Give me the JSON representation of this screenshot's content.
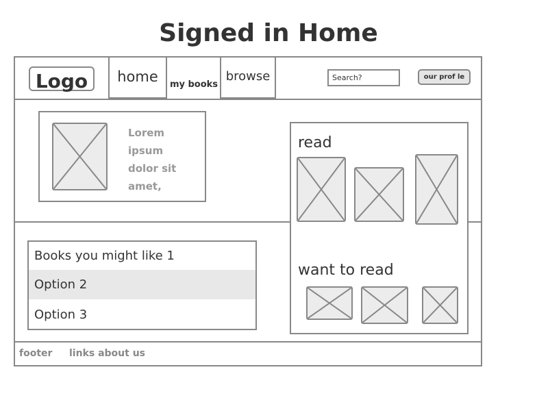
{
  "page": {
    "title": "Signed in Home"
  },
  "header": {
    "logo": "Logo",
    "nav": {
      "home": "home",
      "my_books": "my books",
      "browse": "browse"
    },
    "search": {
      "value": "Search?"
    },
    "profile_button": "our prof le"
  },
  "featured": {
    "text_lines": [
      "Lorem",
      "ipsum",
      "dolor sit",
      "amet,"
    ]
  },
  "recommendations": {
    "options": [
      "Books you might like 1",
      "Option 2",
      "Option 3"
    ]
  },
  "shelf": {
    "read_label": "read",
    "want_label": "want to read"
  },
  "footer": {
    "label": "footer",
    "links": "links about us"
  },
  "colors": {
    "border": "#888888",
    "placeholder_fill": "#ececec",
    "highlight": "#e8e8e8"
  }
}
